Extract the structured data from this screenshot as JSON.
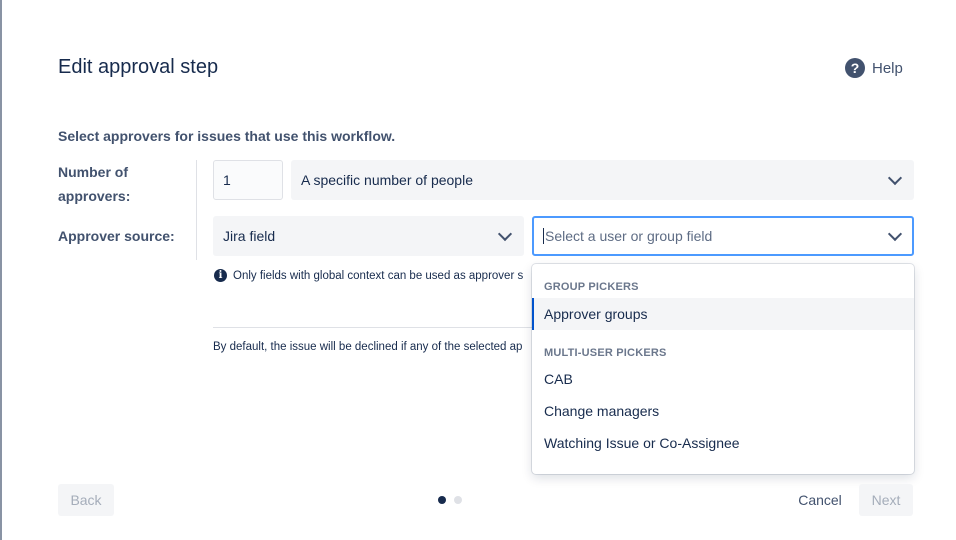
{
  "dialog": {
    "title": "Edit approval step",
    "help_label": "Help",
    "help_icon": "question-circle-icon",
    "intro": "Select approvers for issues that use this workflow."
  },
  "number_of_approvers": {
    "label": "Number of approvers:",
    "value": "1",
    "mode": "A specific number of people"
  },
  "approver_source": {
    "label": "Approver source:",
    "source": "Jira field",
    "field_placeholder": "Select a user or group field"
  },
  "info_note": "Only fields with global context can be used as approver s",
  "default_note": "By default, the issue will be declined if any of the selected ap",
  "dropdown": {
    "groups": [
      {
        "heading": "GROUP PICKERS",
        "options": [
          "Approver groups"
        ]
      },
      {
        "heading": "MULTI-USER PICKERS",
        "options": [
          "CAB",
          "Change managers",
          "Watching Issue or Co-Assignee"
        ]
      }
    ],
    "focused": "Approver groups"
  },
  "footer": {
    "back": "Back",
    "cancel": "Cancel",
    "next": "Next",
    "current_step": 1,
    "total_steps": 2
  },
  "colors": {
    "focus_border": "#4c9aff",
    "selected_indicator": "#0052cc",
    "text": "#172b4d"
  }
}
